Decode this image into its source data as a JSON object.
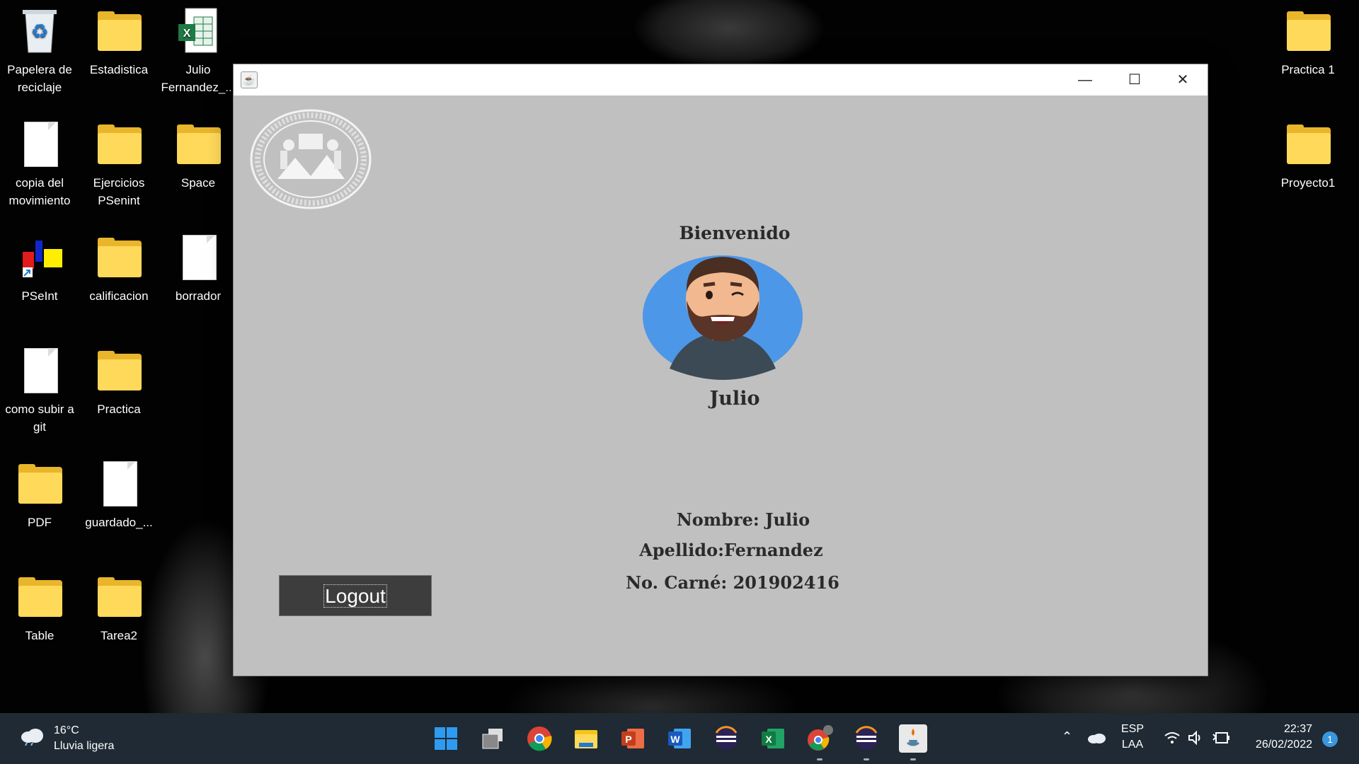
{
  "desktop": {
    "icons": [
      {
        "label": "Papelera de reciclaje",
        "kind": "recycle"
      },
      {
        "label": "Estadistica",
        "kind": "folder"
      },
      {
        "label": "Julio Fernandez_...",
        "kind": "excel"
      },
      {
        "label": "copia del movimiento",
        "kind": "doc"
      },
      {
        "label": "Ejercicios PSenint",
        "kind": "folder"
      },
      {
        "label": "Space",
        "kind": "folder"
      },
      {
        "label": "PSeInt",
        "kind": "pseint"
      },
      {
        "label": "calificacion",
        "kind": "folder"
      },
      {
        "label": "borrador",
        "kind": "doc"
      },
      {
        "label": "como subir a git",
        "kind": "doc"
      },
      {
        "label": "Practica",
        "kind": "folder"
      },
      {
        "label": "PDF",
        "kind": "folder"
      },
      {
        "label": "guardado_...",
        "kind": "doc"
      },
      {
        "label": "Table",
        "kind": "folder"
      },
      {
        "label": "Tarea2",
        "kind": "folder"
      },
      {
        "label": "Practica 1",
        "kind": "folder"
      },
      {
        "label": "Proyecto1",
        "kind": "folder"
      }
    ]
  },
  "window": {
    "icon": "java-icon",
    "controls": {
      "minimize": "—",
      "maximize": "☐",
      "close": "✕"
    },
    "welcome": "Bienvenido",
    "username": "Julio",
    "nombre": "Nombre: Julio",
    "apellido": "Apellido:Fernandez",
    "carne": "No. Carné: 201902416",
    "logout_label": "Logout"
  },
  "taskbar": {
    "weather": {
      "temp": "16°C",
      "desc": "Lluvia ligera"
    },
    "apps": [
      "start-icon",
      "task-view-icon",
      "chrome-icon",
      "file-explorer-icon",
      "powerpoint-icon",
      "word-icon",
      "eclipse-icon",
      "excel-icon",
      "chrome-profile-icon",
      "eclipse-icon",
      "java-icon"
    ],
    "language": {
      "line1": "ESP",
      "line2": "LAA"
    },
    "time": "22:37",
    "date": "26/02/2022",
    "notifications": "1"
  },
  "colors": {
    "window_bg": "#c0c0c0",
    "taskbar_bg": "#1f2a34",
    "folder": "#ffd95a",
    "avatar_bg": "#4d97e8"
  }
}
